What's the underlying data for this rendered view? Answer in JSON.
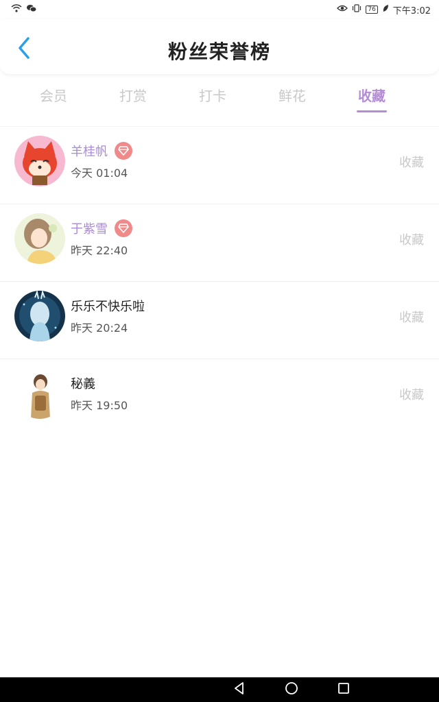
{
  "status_bar": {
    "time": "下午3:02",
    "battery": "76"
  },
  "header": {
    "title": "粉丝荣誉榜"
  },
  "tabs": [
    {
      "label": "会员"
    },
    {
      "label": "打赏"
    },
    {
      "label": "打卡"
    },
    {
      "label": "鲜花"
    },
    {
      "label": "收藏"
    }
  ],
  "active_tab": "收藏",
  "fans": [
    {
      "name": "羊桂帆",
      "time": "今天 01:04",
      "action": "收藏",
      "vip": true
    },
    {
      "name": "于紫雪",
      "time": "昨天 22:40",
      "action": "收藏",
      "vip": true
    },
    {
      "name": "乐乐不快乐啦",
      "time": "昨天 20:24",
      "action": "收藏",
      "vip": false
    },
    {
      "name": "秘義",
      "time": "昨天 19:50",
      "action": "收藏",
      "vip": false
    }
  ],
  "colors": {
    "accent": "#b48cd6",
    "vip_name": "#a98bd3",
    "vip_badge": "#f08a8a",
    "back_arrow": "#2aa0e8"
  }
}
